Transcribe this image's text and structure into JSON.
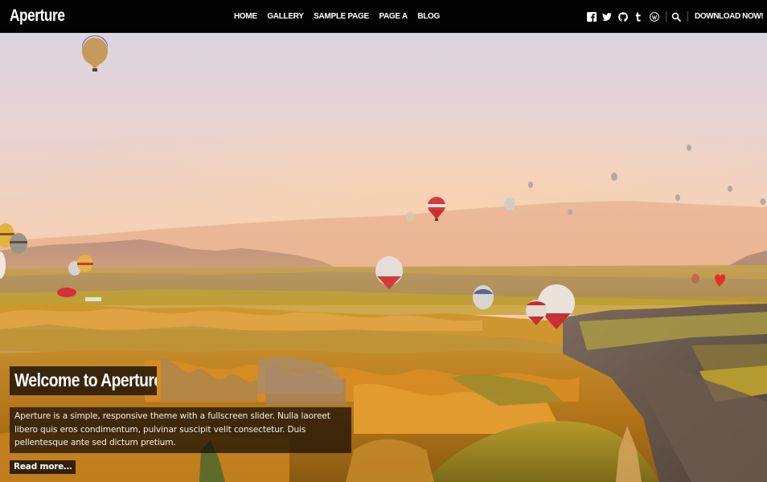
{
  "header": {
    "logo": "Aperture",
    "nav": [
      {
        "label": "HOME"
      },
      {
        "label": "GALLERY"
      },
      {
        "label": "SAMPLE PAGE"
      },
      {
        "label": "PAGE A"
      },
      {
        "label": "BLOG"
      }
    ],
    "social_icons": [
      "facebook-icon",
      "twitter-icon",
      "github-icon",
      "tumblr-icon",
      "wordpress-icon"
    ],
    "search_icon": "search-icon",
    "download_label": "DOWNLOAD NOW!"
  },
  "slide": {
    "title": "Welcome to Aperture!",
    "text": "Aperture is a simple, responsive theme with a fullscreen slider. Nulla laoreet libero quis eros condimentum, pulvinar suscipit velit consectetur. Duis pellentesque ante sed dictum pretium.",
    "read_more": "Read more…",
    "image": "hot-air-balloons-over-cappadocia-landscape"
  },
  "colors": {
    "header_bg": "#030303",
    "sky_top": "#d8d6e2",
    "sky_bottom": "#f6bd8e",
    "caption_bg": "#140c04"
  }
}
